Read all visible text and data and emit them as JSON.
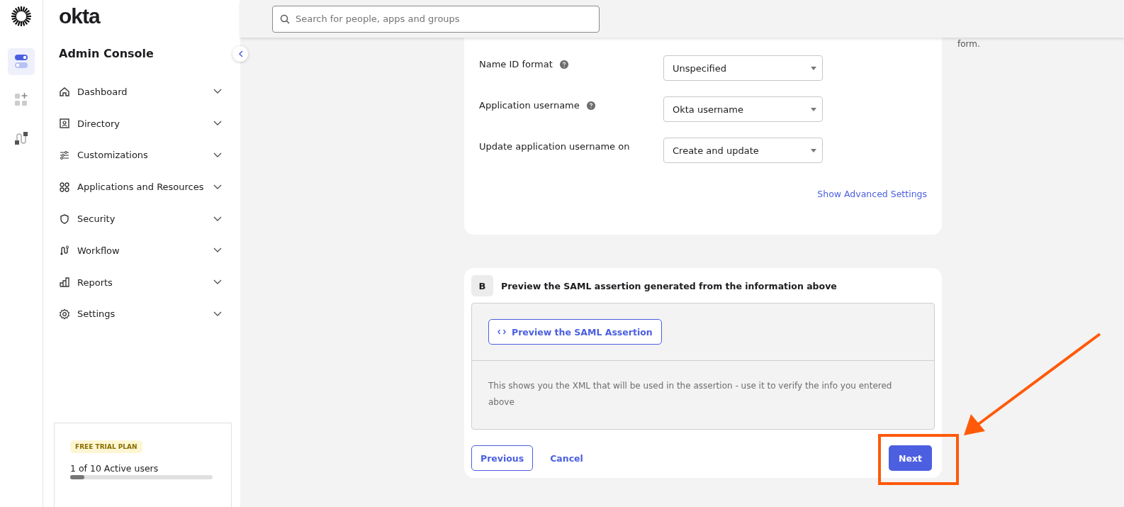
{
  "brand": {
    "wordmark": "okta",
    "title": "Admin Console"
  },
  "rail": [
    {
      "selected": true
    },
    {
      "selected": false
    },
    {
      "selected": false
    }
  ],
  "nav": [
    {
      "label": "Dashboard"
    },
    {
      "label": "Directory"
    },
    {
      "label": "Customizations"
    },
    {
      "label": "Applications and Resources"
    },
    {
      "label": "Security"
    },
    {
      "label": "Workflow"
    },
    {
      "label": "Reports"
    },
    {
      "label": "Settings"
    }
  ],
  "trial": {
    "badge": "FREE TRIAL PLAN",
    "users": "1 of 10 Active users",
    "level": 0.1
  },
  "search": {
    "placeholder": "Search for people, apps and groups"
  },
  "side_note": "form.",
  "settings": [
    {
      "label": "Name ID format",
      "help": true,
      "value": "Unspecified"
    },
    {
      "label": "Application username",
      "help": true,
      "value": "Okta username"
    },
    {
      "label": "Update application username on",
      "help": false,
      "value": "Create and update"
    }
  ],
  "advanced_link": "Show Advanced Settings",
  "preview": {
    "step": "B",
    "heading": "Preview the SAML assertion generated from the information above",
    "button": "Preview the SAML Assertion",
    "note": "This shows you the XML that will be used in the assertion - use it to verify the info you entered above"
  },
  "actions": {
    "previous": "Previous",
    "cancel": "Cancel",
    "next": "Next"
  }
}
